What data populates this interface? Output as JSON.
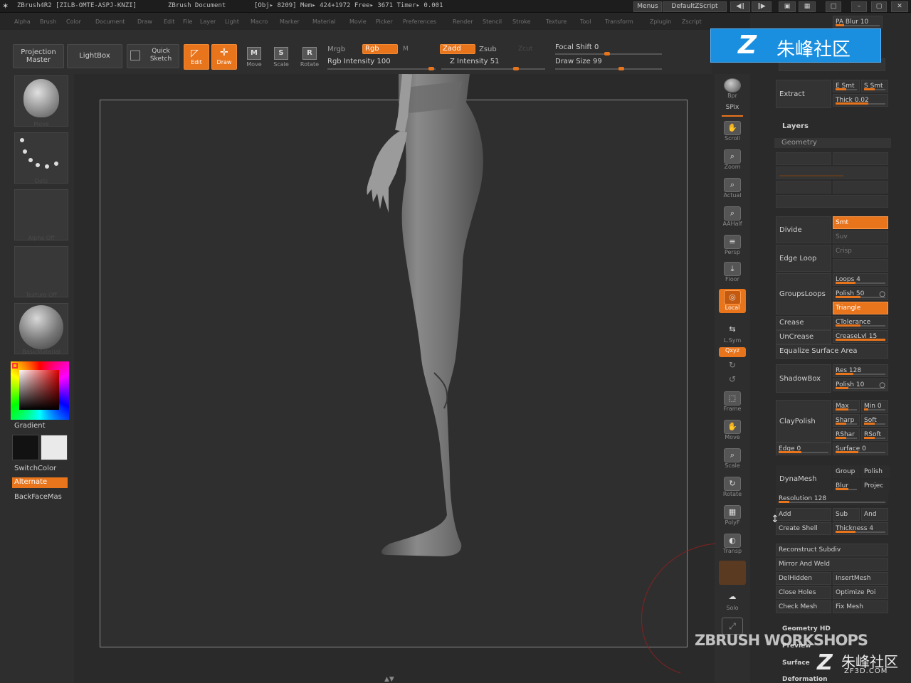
{
  "titlebar": {
    "app": "ZBrush4R2  [ZILB-OMTE-ASPJ-KNZI]",
    "doc": "ZBrush Document",
    "stats": "[Obj▸ 8209]  Mem▸ 424+1972  Free▸ 3671  Timer▸ 0.001",
    "menus_btn": "Menus",
    "script_btn": "DefaultZScript"
  },
  "menubar": {
    "items": [
      "Alpha",
      "Brush",
      "Color",
      "Document",
      "Draw",
      "Edit",
      "File",
      "Layer",
      "Light",
      "Macro",
      "Marker",
      "Material",
      "Movie",
      "Picker",
      "Preferences",
      "Render",
      "Stencil",
      "Stroke",
      "Texture",
      "Tool",
      "Transform",
      "Zplugin",
      "Zscript"
    ]
  },
  "toolbar": {
    "projection_master": "Projection Master",
    "lightbox": "LightBox",
    "quick_sketch": "Quick Sketch",
    "edit": "Edit",
    "draw": "Draw",
    "move": "Move",
    "scale": "Scale",
    "rotate": "Rotate",
    "mrgb": "Mrgb",
    "rgb": "Rgb",
    "m": "M",
    "rgb_intensity": "Rgb Intensity 100",
    "zadd": "Zadd",
    "zsub": "Zsub",
    "zcut": "Zcut",
    "z_intensity": "Z Intensity 51",
    "focal_shift": "Focal Shift 0",
    "draw_size": "Draw Size 99"
  },
  "left": {
    "brush_cap": "Move",
    "stroke_cap": "Dots",
    "alpha_cap": "Alpha Off",
    "texture_cap": "Texture Off",
    "material_cap": "BasicMaterial",
    "gradient": "Gradient",
    "switchcolor": "SwitchColor",
    "alternate": "Alternate",
    "backfacemask": "BackFaceMas"
  },
  "right_shelf": {
    "bpr": "Bpr",
    "spix": "SPix",
    "scroll": "Scroll",
    "zoom": "Zoom",
    "actual": "Actual",
    "aahalf": "AAHalf",
    "persp": "Persp",
    "floor": "Floor",
    "local": "Local",
    "lsym": "L.Sym",
    "xyz": "Qxyz",
    "frame": "Frame",
    "move": "Move",
    "scale": "Scale",
    "rotate": "Rotate",
    "polyf": "PolyF",
    "transp": "Transp",
    "ghost": "Ghost",
    "solo": "Solo"
  },
  "panel": {
    "pa_blur": "PA Blur 10",
    "extract": "Extract",
    "e_smt": "E Smt",
    "s_smt": "S Smt",
    "thick": "Thick 0.02",
    "layers": "Layers",
    "geometry": "Geometry",
    "divide": "Divide",
    "smt": "Smt",
    "suv": "Suv",
    "edge_loop": "Edge Loop",
    "crisp": "Crisp",
    "groupsloops": "GroupsLoops",
    "loops": "Loops 4",
    "polish": "Polish 50",
    "triangle": "Triangle",
    "crease": "Crease",
    "ctolerance": "CTolerance",
    "uncrease": "UnCrease",
    "creaselvl": "CreaseLvl 15",
    "equalize": "Equalize Surface Area",
    "shadowbox": "ShadowBox",
    "res": "Res 128",
    "polish10": "Polish 10",
    "claypolish": "ClayPolish",
    "max": "Max",
    "min": "Min 0",
    "sharp": "Sharp",
    "soft": "Soft",
    "rshar": "RShar",
    "rsoft": "RSoft",
    "edge": "Edge 0",
    "surface": "Surface 0",
    "dynamesh": "DynaMesh",
    "group": "Group",
    "polish_dm": "Polish",
    "blur": "Blur",
    "project": "Projec",
    "resolution": "Resolution 128",
    "add": "Add",
    "sub": "Sub",
    "and": "And",
    "create_shell": "Create Shell",
    "thickness": "Thickness 4",
    "reconstruct": "Reconstruct Subdiv",
    "mirror_weld": "Mirror And Weld",
    "delhidden": "DelHidden",
    "insertmesh": "InsertMesh",
    "close_holes": "Close Holes",
    "optimize": "Optimize Poi",
    "check_mesh": "Check Mesh",
    "fix_mesh": "Fix Mesh",
    "geometry_hd": "Geometry HD",
    "preview": "Preview",
    "surface_sec": "Surface",
    "deformation": "Deformation"
  },
  "watermarks": {
    "logo_text": "朱峰社区",
    "workshops": "ZBRUSH WORKSHOPS",
    "corner_cn": "朱峰社区",
    "corner_url": "ZF3D.COM"
  },
  "colors": {
    "accent": "#e8741c",
    "background": "#2b2b2b",
    "logo_blue": "#1a8fe0"
  }
}
